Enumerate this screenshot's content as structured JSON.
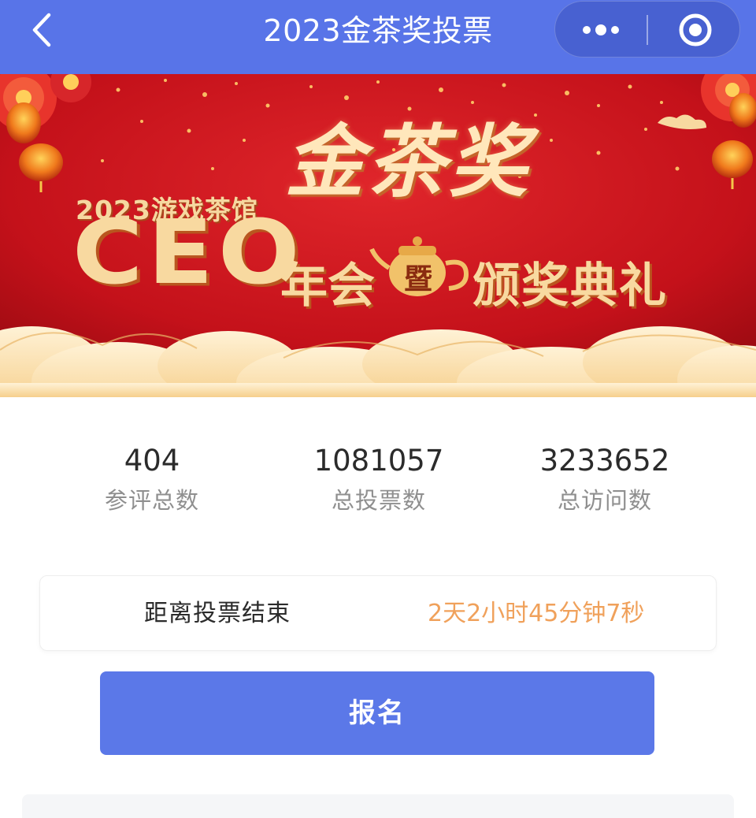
{
  "navbar": {
    "title": "2023金茶奖投票",
    "back_icon": "chevron-left-icon",
    "more_icon": "more-dots-icon",
    "close_icon": "target-circle-icon",
    "bg_color": "#5874e8"
  },
  "banner": {
    "year_text": "2023游戏茶馆",
    "ceo_text": "CEO",
    "main_title": "金茶奖",
    "annual_text": "年会",
    "ji_text": "暨",
    "ceremony_text": "颁奖典礼",
    "bg_color": "#c8101a",
    "text_color": "#f8d9a0"
  },
  "stats": [
    {
      "value": "404",
      "label": "参评总数"
    },
    {
      "value": "1081057",
      "label": "总投票数"
    },
    {
      "value": "3233652",
      "label": "总访问数"
    }
  ],
  "countdown": {
    "label": "距离投票结束",
    "value": "2天2小时45分钟7秒",
    "value_color": "#f0a15b"
  },
  "register": {
    "label": "报名",
    "color": "#5b78e8"
  }
}
